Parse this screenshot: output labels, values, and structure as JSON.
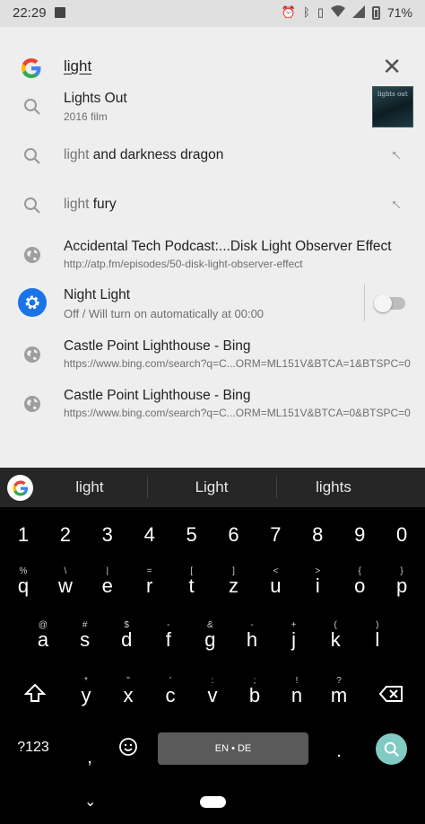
{
  "status": {
    "time": "22:29",
    "battery": "71%",
    "icons": [
      "image-icon",
      "alarm-icon",
      "bluetooth-icon",
      "vibrate-icon",
      "wifi-icon",
      "signal-icon",
      "battery-icon"
    ]
  },
  "search": {
    "query": "light",
    "clear_icon": "close-icon"
  },
  "suggestions": [
    {
      "title": "Lights Out",
      "subtitle": "2016 film",
      "thumb_text": "lights out"
    },
    {
      "prefix": "light",
      "rest": " and darkness dragon"
    },
    {
      "prefix": "light",
      "rest": " fury"
    },
    {
      "title": "Accidental Tech Podcast:...Disk Light Observer Effect",
      "url": "http://atp.fm/episodes/50-disk-light-observer-effect"
    },
    {
      "title": "Night Light",
      "subtitle": "Off / Will turn on automatically at 00:00",
      "toggle_on": false
    },
    {
      "title": "Castle Point Lighthouse - Bing",
      "url": "https://www.bing.com/search?q=C...ORM=ML151V&BTCA=1&BTSPC=0"
    },
    {
      "title": "Castle Point Lighthouse - Bing",
      "url": "https://www.bing.com/search?q=C...ORM=ML151V&BTCA=0&BTSPC=0"
    }
  ],
  "keyboard": {
    "suggestions": [
      "light",
      "Light",
      "lights"
    ],
    "numbers": [
      "1",
      "2",
      "3",
      "4",
      "5",
      "6",
      "7",
      "8",
      "9",
      "0"
    ],
    "row1": [
      "q",
      "w",
      "e",
      "r",
      "t",
      "z",
      "u",
      "i",
      "o",
      "p"
    ],
    "row1_hints": [
      "%",
      "\\",
      "|",
      "=",
      "[",
      "]",
      "<",
      ">",
      "{",
      "}"
    ],
    "row2": [
      "a",
      "s",
      "d",
      "f",
      "g",
      "h",
      "j",
      "k",
      "l"
    ],
    "row2_hints": [
      "@",
      "#",
      "$",
      "-",
      "&",
      "-",
      "+",
      "(",
      ")"
    ],
    "row3": [
      "y",
      "x",
      "c",
      "v",
      "b",
      "n",
      "m"
    ],
    "row3_hints": [
      "*",
      "\"",
      "'",
      ":",
      ";",
      "!",
      "?"
    ],
    "symbols_key": "?123",
    "comma": ",",
    "period": ".",
    "space_label": "EN • DE"
  },
  "colors": {
    "panel_bg": "#eeeeee",
    "keyboard_bg": "#000000",
    "accent_blue": "#1a73e8",
    "search_key": "#80cbc4"
  }
}
